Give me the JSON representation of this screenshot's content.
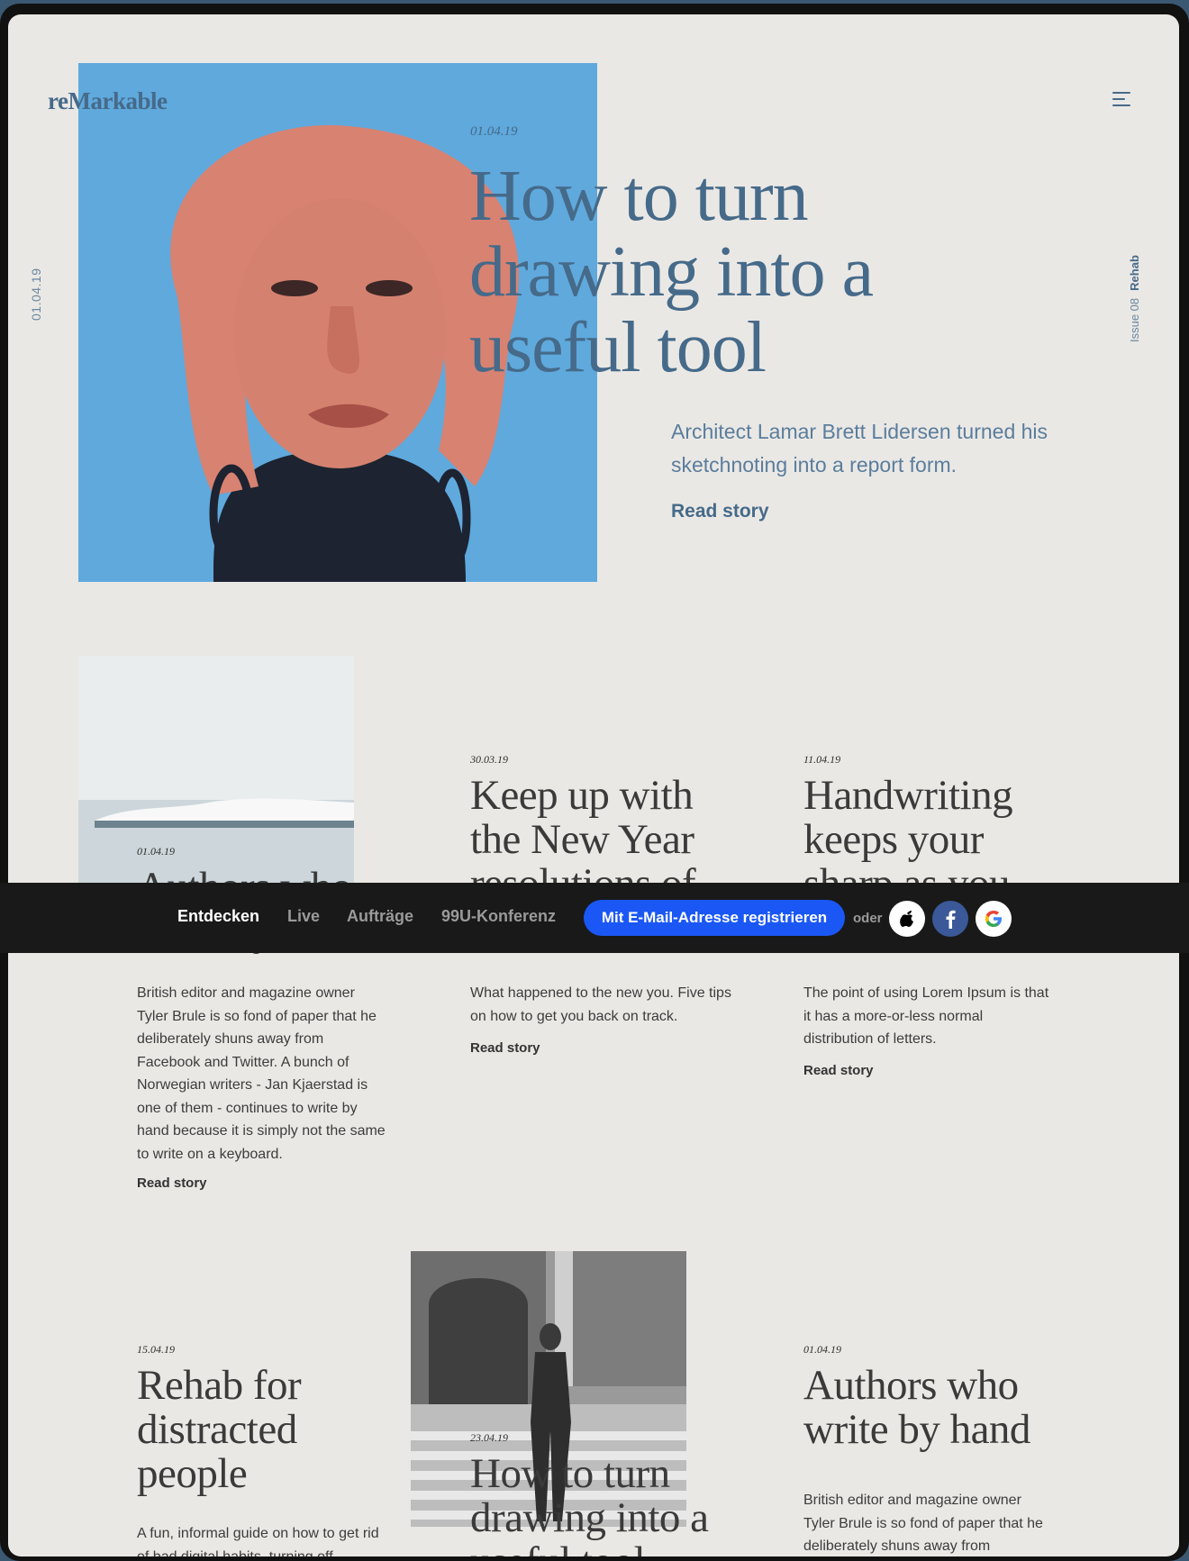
{
  "brand": {
    "logo": "reMarkable"
  },
  "side": {
    "date": "01.04.19",
    "issue": "Issue 08",
    "section": "Rehab"
  },
  "hero": {
    "date": "01.04.19",
    "title": "How to turn drawing into a useful tool",
    "description": "Architect Lamar Brett Lidersen turned his sketchnoting into a report form.",
    "read_label": "Read story"
  },
  "cards_row1": [
    {
      "date": "01.04.19",
      "title": "Authors who write by hand",
      "description": "British editor and magazine owner Tyler Brule is so fond of paper that he deliberately shuns away from Facebook and Twitter. A bunch of Norwegian writers - Jan Kjaerstad is one of them - continues to write by hand because it is simply not the same to write on a keyboard.",
      "read_label": "Read story"
    },
    {
      "date": "30.03.19",
      "title": "Keep up with the New Year resolutions of",
      "description": "What happened to the new you. Five tips on how to get you back on track.",
      "read_label": "Read story"
    },
    {
      "date": "11.04.19",
      "title": "Handwriting keeps your sharp as you",
      "description": "The point of using Lorem Ipsum is that it has a more-or-less normal distribution of letters.",
      "read_label": "Read story"
    }
  ],
  "cards_row2": [
    {
      "date": "15.04.19",
      "title": "Rehab for distracted people",
      "description": "A fun, informal guide on how to get rid of bad digital habits, turning off"
    },
    {
      "date": "23.04.19",
      "title": "How to turn drawing into a useful tool"
    },
    {
      "date": "01.04.19",
      "title": "Authors who write by hand",
      "description": "British editor and magazine owner Tyler Brule is so fond of paper that he deliberately shuns away from Facebook and Twitter. A bunch of"
    }
  ],
  "signup_bar": {
    "nav": [
      "Entdecken",
      "Live",
      "Aufträge",
      "99U-Konferenz"
    ],
    "cta_label": "Mit E-Mail-Adresse registrieren",
    "or_label": "oder",
    "social": [
      "apple-icon",
      "facebook-icon",
      "google-icon"
    ],
    "colors": {
      "bar": "#191919",
      "cta": "#1a57f5",
      "facebook": "#3b5998"
    }
  },
  "colors": {
    "accent": "#466a89",
    "background": "#eae8e5",
    "hero_image": "#5fa9dd"
  }
}
